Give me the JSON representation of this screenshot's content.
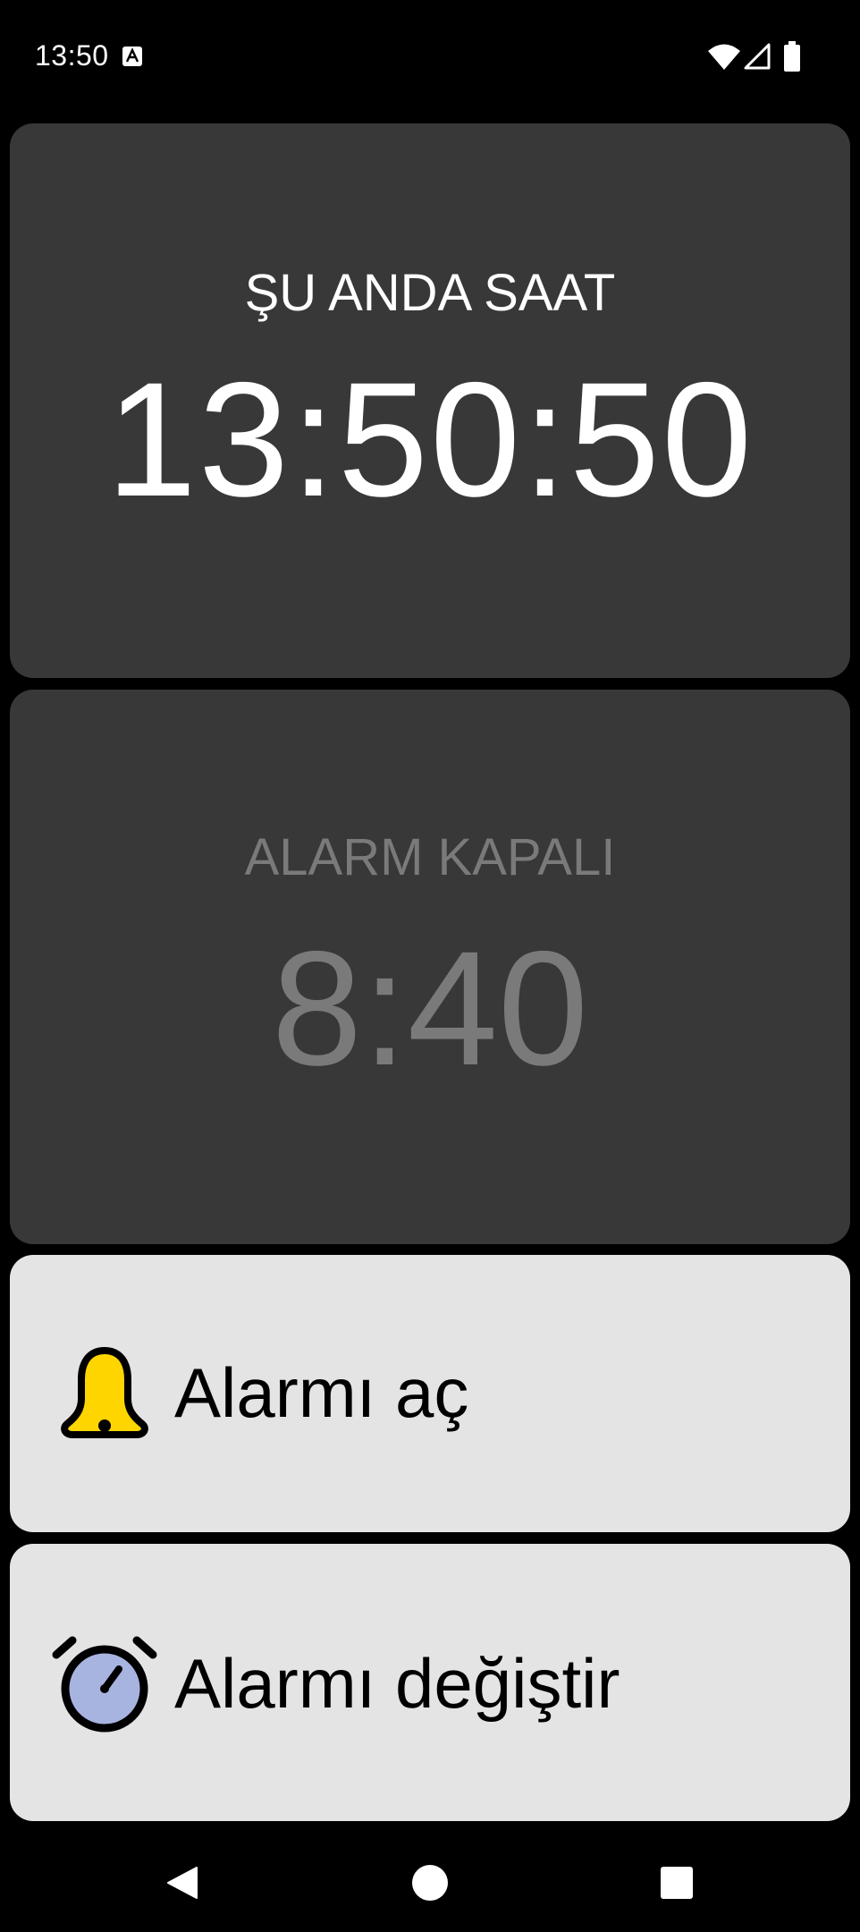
{
  "status_bar": {
    "time": "13:50"
  },
  "current_time_card": {
    "label": "ŞU ANDA SAAT",
    "time": "13:50:50"
  },
  "alarm_card": {
    "label": "ALARM KAPALI",
    "time": "8:40"
  },
  "actions": {
    "enable_alarm_label": "Alarmı aç",
    "change_alarm_label": "Alarmı değiştir"
  },
  "icons": {
    "notification": "text-notification-icon",
    "wifi": "wifi-icon",
    "signal": "cellular-signal-icon",
    "battery": "battery-icon",
    "bell": "bell-icon",
    "alarm_clock": "alarm-clock-icon",
    "back": "back-icon",
    "home": "home-icon",
    "recents": "recents-icon"
  },
  "colors": {
    "background": "#000000",
    "card_dark": "#383838",
    "card_light": "#e4e4e4",
    "disabled_text": "#7a7a7a",
    "bell_yellow": "#ffd500",
    "clock_face": "#a8b4e0"
  }
}
